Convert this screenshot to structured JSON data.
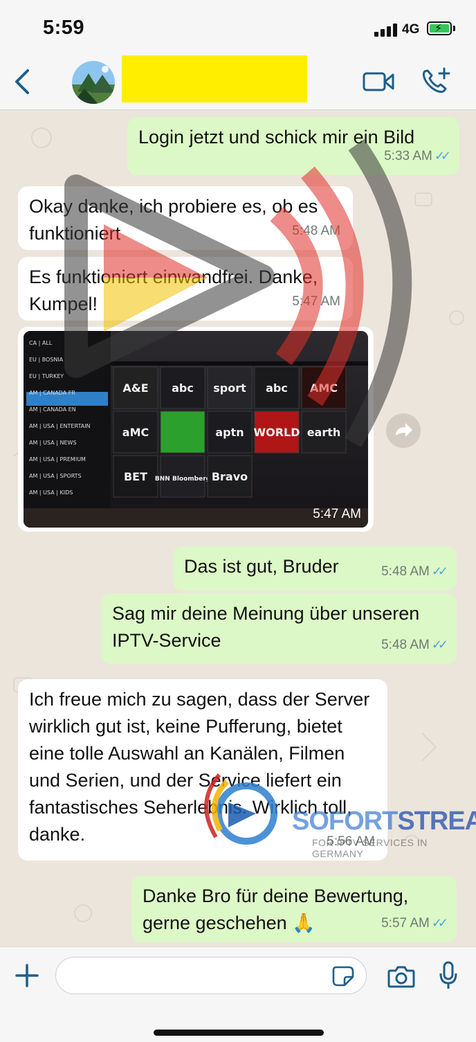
{
  "status_bar": {
    "time": "5:59",
    "network": "4G",
    "battery_charging": true
  },
  "header": {
    "contact_name": "",
    "icons": [
      "back-chevron-icon",
      "video-call-icon",
      "voice-call-plus-icon"
    ]
  },
  "messages": [
    {
      "id": "m1",
      "direction": "outgoing",
      "text": "Login jetzt und schick mir ein Bild",
      "time": "5:33 AM",
      "read": true
    },
    {
      "id": "m2",
      "direction": "incoming",
      "text": "Okay danke, ich probiere es, ob es funktioniert",
      "time": "5:48 AM"
    },
    {
      "id": "m3",
      "direction": "incoming",
      "text": "Es funktioniert einwandfrei. Danke, Kumpel!",
      "time": "5:47 AM"
    },
    {
      "id": "m4",
      "direction": "incoming",
      "type": "image",
      "time": "5:47 AM",
      "image": {
        "menu_items": [
          "CA | ALL",
          "EU | BOSNIA",
          "EU | TURKEY",
          "AM | CANADA FR",
          "AM | CANADA EN",
          "AM | USA | ENTERTAIN",
          "AM | USA | NEWS",
          "AM | USA | PREMIUM",
          "AM | USA | SPORTS",
          "AM | USA | KIDS"
        ],
        "channels": [
          "A&E",
          "abc",
          "sport",
          "abc",
          "AMC",
          "aMC",
          "",
          "aptn",
          "WORLD",
          "earth",
          "BET",
          "BNN Bloomberg",
          "Bravo"
        ]
      }
    },
    {
      "id": "m5",
      "direction": "outgoing",
      "text": "Das ist gut, Bruder",
      "time": "5:48 AM",
      "read": true
    },
    {
      "id": "m6",
      "direction": "outgoing",
      "text": "Sag mir deine Meinung über unseren IPTV-Service",
      "time": "5:48 AM",
      "read": true
    },
    {
      "id": "m7",
      "direction": "incoming",
      "text": "Ich freue mich zu sagen, dass der Server wirklich gut ist, keine Pufferung, bietet eine tolle Auswahl an Kanälen, Filmen und Serien, und der Service liefert ein fantastisches Seherlebnis. Wirklich toll, danke.",
      "time": "5:56 AM"
    },
    {
      "id": "m8",
      "direction": "outgoing",
      "text": "Danke Bro für deine Bewertung, gerne geschehen 🙏",
      "time": "5:57 AM",
      "read": true
    }
  ],
  "watermark": {
    "brand_part1": "SOFORT",
    "brand_part2": "STREAM",
    "tagline": "FOR IPTV SERVICES IN GERMANY"
  },
  "composer": {
    "value": "",
    "placeholder": ""
  },
  "colors": {
    "outgoing_bubble": "#dcf8c6",
    "incoming_bubble": "#ffffff",
    "accent": "#1d5e8c",
    "read_ticks": "#4fa3e0"
  }
}
